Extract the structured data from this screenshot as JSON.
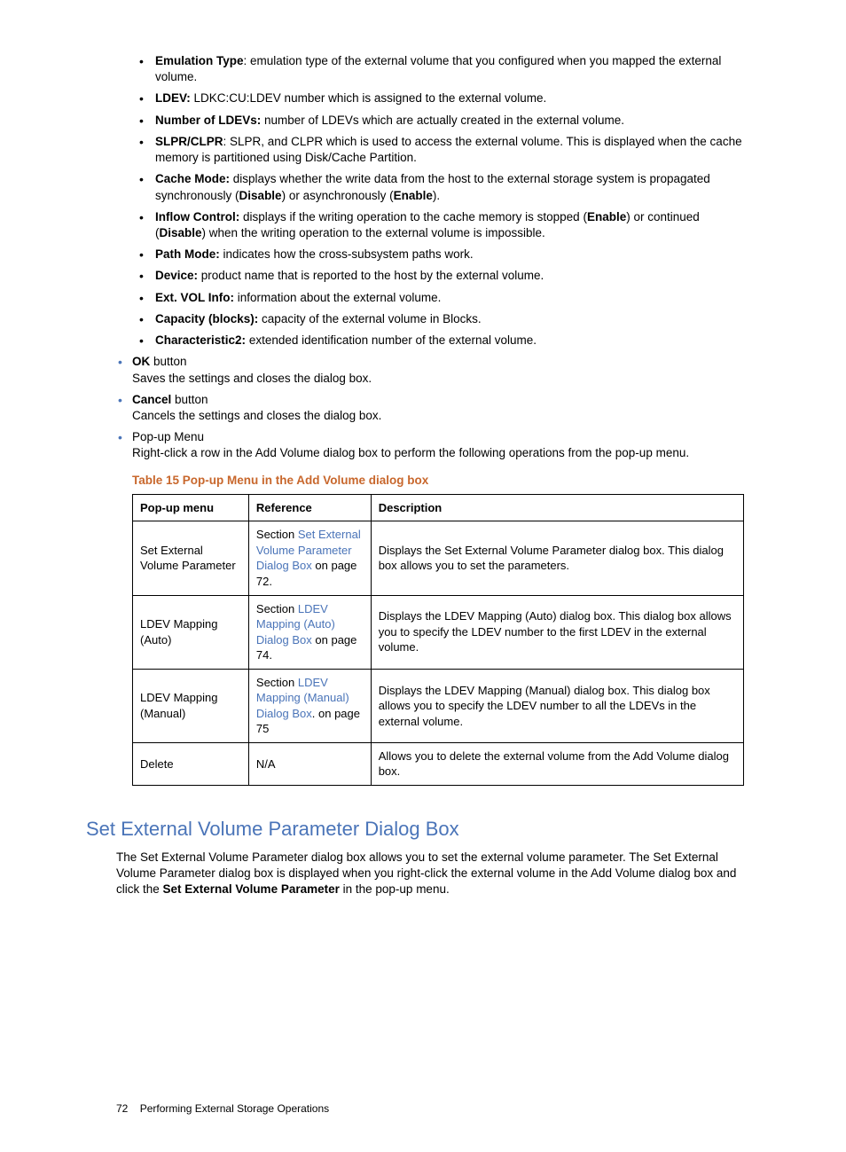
{
  "inner_list": [
    {
      "term": "Emulation Type",
      "sep": ": ",
      "text": "emulation type of the external volume that you configured when you mapped the external volume."
    },
    {
      "term": "LDEV:",
      "sep": " ",
      "text": "LDKC:CU:LDEV number which is assigned to the external volume."
    },
    {
      "term": "Number of LDEVs:",
      "sep": " ",
      "text": "number of LDEVs which are actually created in the external volume."
    },
    {
      "term": "SLPR/CLPR",
      "sep": ": ",
      "text": "SLPR, and CLPR which is used to access the external volume. This is displayed when the cache memory is partitioned using Disk/Cache Partition."
    },
    {
      "term": "Cache Mode:",
      "sep": " ",
      "text_parts": [
        "displays whether the write data from the host to the external storage system is propagated synchronously (",
        "Disable",
        ") or asynchronously (",
        "Enable",
        ")."
      ]
    },
    {
      "term": "Inflow Control:",
      "sep": " ",
      "text_parts": [
        "displays if the writing operation to the cache memory is stopped (",
        "Enable",
        ") or continued (",
        "Disable",
        ") when the writing operation to the external volume is impossible."
      ]
    },
    {
      "term": "Path Mode:",
      "sep": " ",
      "text": "indicates how the cross-subsystem paths work."
    },
    {
      "term": "Device:",
      "sep": " ",
      "text": "product name that is reported to the host by the external volume."
    },
    {
      "term": "Ext. VOL Info:",
      "sep": " ",
      "text": "information about the external volume."
    },
    {
      "term": "Capacity (blocks):",
      "sep": " ",
      "text": "capacity of the external volume in Blocks."
    },
    {
      "term": "Characteristic2:",
      "sep": " ",
      "text": "extended identification number of the external volume."
    }
  ],
  "outer_list": [
    {
      "term": "OK",
      "post": " button",
      "desc": "Saves the settings and closes the dialog box."
    },
    {
      "term": "Cancel",
      "post": " button",
      "desc": "Cancels the settings and closes the dialog box."
    },
    {
      "plain": "Pop-up Menu",
      "desc": "Right-click a row in the Add Volume dialog box to perform the following operations from the pop-up menu."
    }
  ],
  "table_caption": "Table 15 Pop-up Menu in the Add Volume dialog box",
  "table_headers": [
    "Pop-up menu",
    "Reference",
    "Description"
  ],
  "table_rows": [
    {
      "menu": "Set External Volume Parameter",
      "ref_pre": "Section ",
      "ref_link": "Set External Volume Parameter Dialog Box",
      "ref_post": " on page 72.",
      "desc": "Displays the Set External Volume Parameter dialog box. This dialog box allows you to set the parameters."
    },
    {
      "menu": "LDEV Mapping (Auto)",
      "ref_pre": "Section ",
      "ref_link": "LDEV Mapping (Auto) Dialog Box",
      "ref_post": " on page 74.",
      "desc": "Displays the LDEV Mapping (Auto) dialog box. This dialog box allows you to specify the LDEV number to the first LDEV in the external volume."
    },
    {
      "menu": "LDEV Mapping (Manual)",
      "ref_pre": "Section ",
      "ref_link": "LDEV Mapping (Manual) Dialog Box",
      "ref_post": ". on page 75",
      "desc": "Displays the LDEV Mapping (Manual) dialog box. This dialog box allows you to specify the LDEV number to all the LDEVs in the external volume."
    },
    {
      "menu": "Delete",
      "ref_plain": "N/A",
      "desc": "Allows you to delete the external volume from the Add Volume dialog box."
    }
  ],
  "section_heading": "Set External Volume Parameter Dialog Box",
  "section_text_parts": [
    "The Set External Volume Parameter dialog box allows you to set the external volume parameter. The Set External Volume Parameter dialog box is displayed when you right-click the external volume in the Add Volume dialog box and click the ",
    "Set External Volume Parameter",
    " in the pop-up menu."
  ],
  "footer": {
    "page": "72",
    "chapter": "Performing External Storage Operations"
  }
}
